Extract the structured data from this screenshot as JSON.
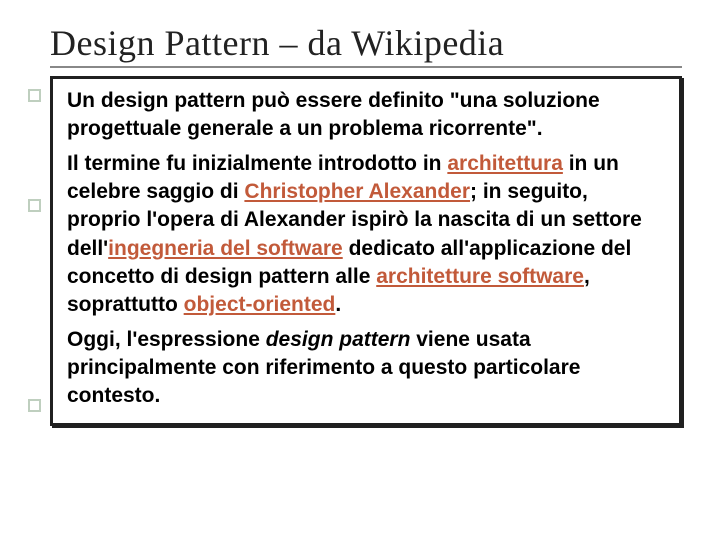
{
  "title": "Design Pattern –  da Wikipedia",
  "p1": {
    "t1": "Un design pattern può essere definito \"una soluzione progettuale generale a un problema ricorrente\"."
  },
  "p2": {
    "t1": "Il termine fu inizialmente introdotto in ",
    "link1": "architettura",
    "t2": " in un celebre saggio di ",
    "link2": "Christopher Alexander",
    "t3": "; in seguito, proprio l'opera di Alexander ispirò la nascita di un settore dell'",
    "link3": "ingegneria del software",
    "t4": " dedicato all'applicazione del concetto di design pattern alle ",
    "link4": "architetture software",
    "t5": ", soprattutto ",
    "link5": "object-oriented",
    "t6": "."
  },
  "p3": {
    "t1": "Oggi, l'espressione ",
    "italic": "design pattern",
    "t2": " viene usata principalmente con riferimento a questo particolare contesto."
  }
}
